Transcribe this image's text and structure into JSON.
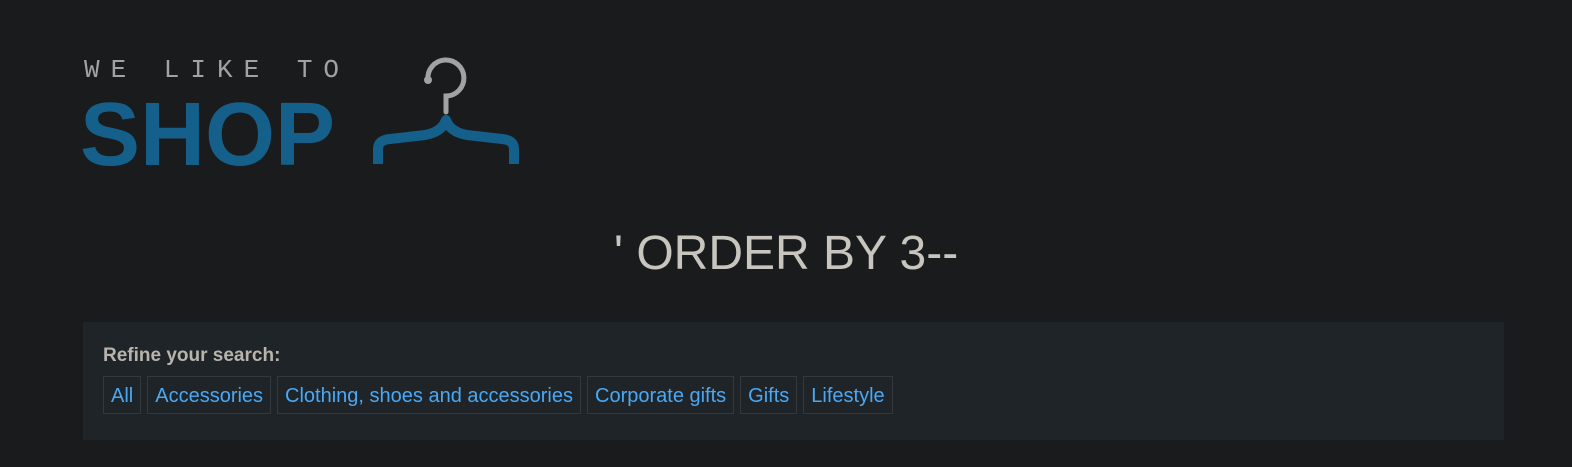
{
  "logo": {
    "tagline": "WE LIKE TO",
    "wordmark": "SHOP",
    "icon": "hanger-icon",
    "colors": {
      "wordmark": "#14608a",
      "tagline": "#a2a2a2"
    }
  },
  "page_title": "' ORDER BY 3--",
  "filter": {
    "label": "Refine your search:",
    "categories": [
      "All",
      "Accessories",
      "Clothing, shoes and accessories",
      "Corporate gifts",
      "Gifts",
      "Lifestyle"
    ]
  },
  "colors": {
    "background": "#1a1b1d",
    "panel": "#1e2428",
    "link": "#4aa8f5",
    "title": "#c8c5bf"
  }
}
